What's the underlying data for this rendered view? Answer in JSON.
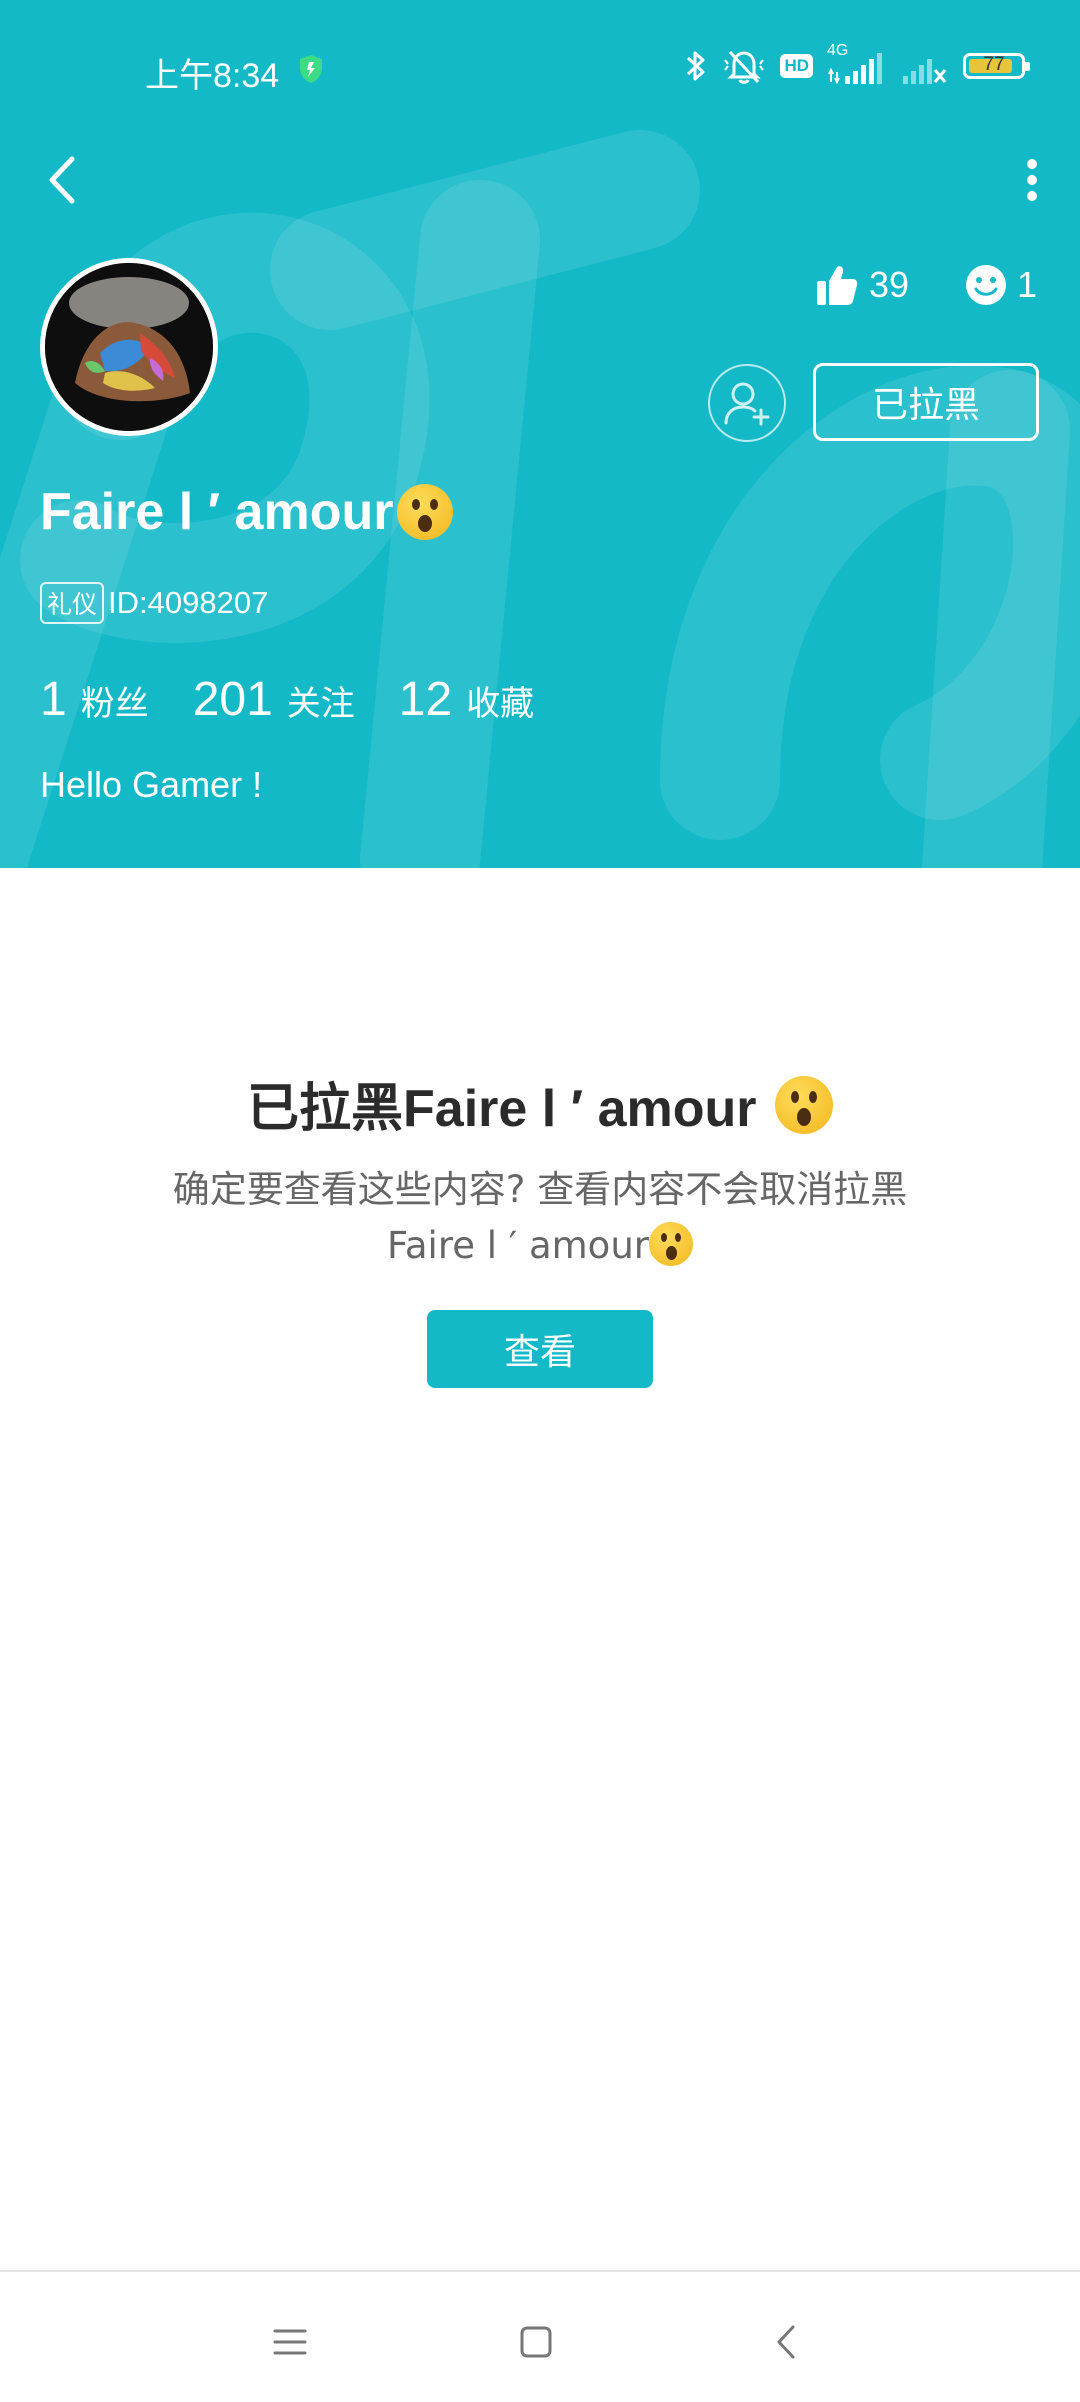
{
  "status_bar": {
    "time": "上午8:34",
    "network": "4G",
    "hd_label": "HD",
    "battery": "77"
  },
  "profile": {
    "likes": "39",
    "smiles": "1",
    "blocked_button": "已拉黑",
    "username": "Faire l ′ amour",
    "badge": "礼仪",
    "id": "ID:4098207",
    "fans_count": "1",
    "fans_label": "粉丝",
    "following_count": "201",
    "following_label": "关注",
    "favorites_count": "12",
    "favorites_label": "收藏",
    "bio": "Hello Gamer !"
  },
  "blocked_notice": {
    "title": "已拉黑Faire l ′ amour",
    "description_line1": "确定要查看这些内容? 查看内容不会取消拉黑",
    "description_line2": "Faire l ′ amour",
    "view_button": "查看"
  },
  "colors": {
    "accent": "#14b9c8",
    "header_bg": "#14b9c8"
  },
  "icons": [
    "back-arrow-icon",
    "more-vertical-icon",
    "thumbs-up-icon",
    "smile-icon",
    "add-user-icon",
    "menu-icon",
    "home-square-icon",
    "nav-back-icon"
  ]
}
